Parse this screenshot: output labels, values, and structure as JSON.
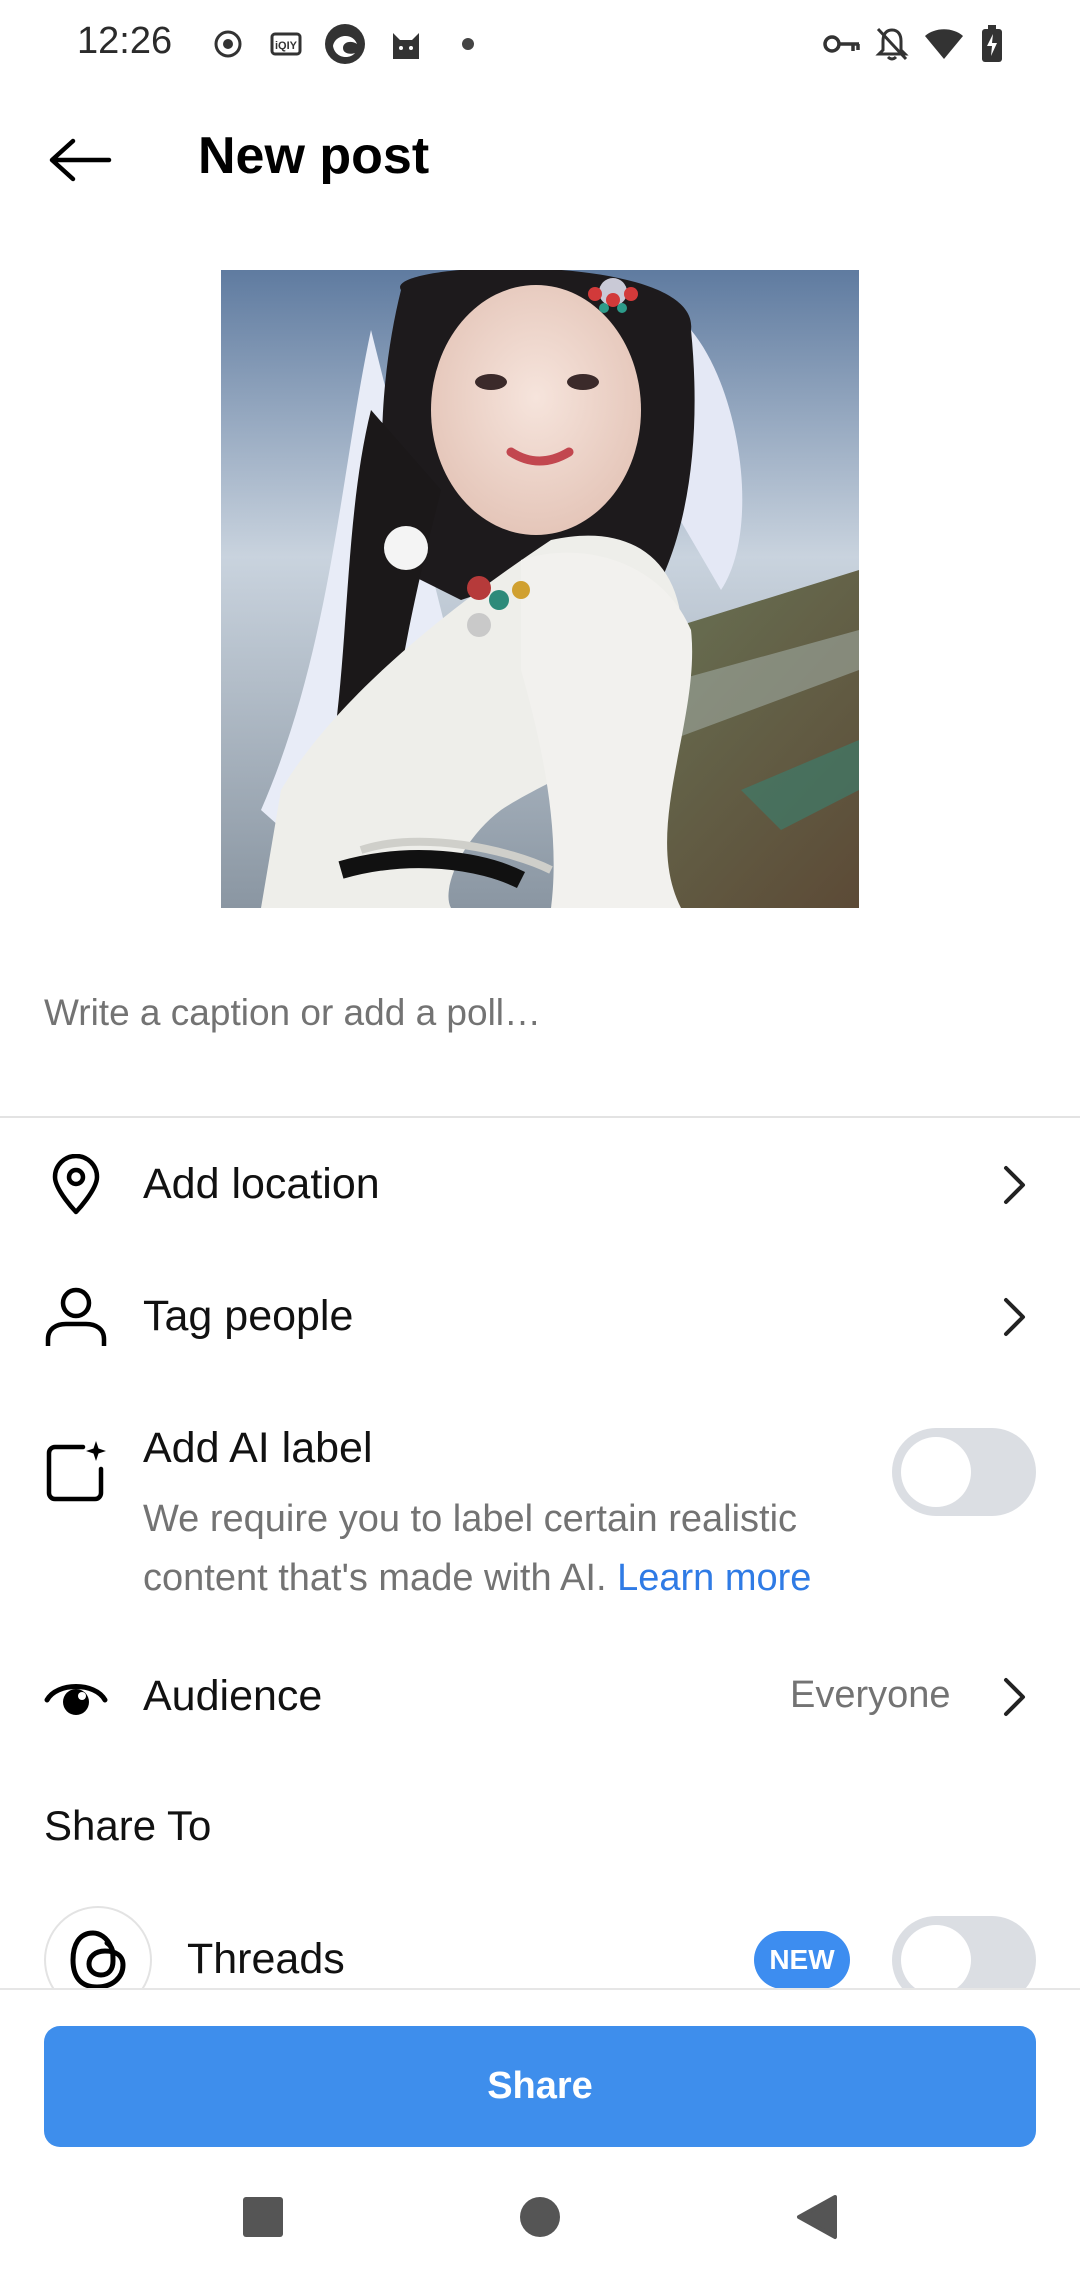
{
  "status_bar": {
    "time": "12:26",
    "left_icons": [
      "record-icon",
      "iqiyi-icon",
      "edge-browser-icon",
      "cat-app-icon",
      "dot-icon"
    ],
    "right_icons": [
      "vpn-key-icon",
      "bell-off-icon",
      "wifi-icon",
      "battery-charging-icon"
    ],
    "iqiyi_text": "iQIY"
  },
  "header": {
    "title": "New post",
    "back_icon": "arrow-left-icon"
  },
  "media": {
    "thumbnail": "photo-thumbnail"
  },
  "caption": {
    "placeholder": "Write a caption or add a poll…",
    "value": ""
  },
  "options": {
    "location": {
      "label": "Add location",
      "icon": "location-pin-icon"
    },
    "tag_people": {
      "label": "Tag people",
      "icon": "person-icon"
    },
    "ai_label": {
      "label": "Add AI label",
      "description": "We require you to label certain realistic content that's made with AI.",
      "link": "Learn more",
      "enabled": false,
      "icon": "ai-sparkle-icon"
    },
    "audience": {
      "label": "Audience",
      "value": "Everyone",
      "icon": "eye-icon"
    }
  },
  "share_to": {
    "header": "Share To",
    "threads": {
      "label": "Threads",
      "badge": "NEW",
      "enabled": false,
      "icon": "threads-logo-icon"
    }
  },
  "actions": {
    "share_label": "Share"
  },
  "nav_bar": {
    "icons": [
      "recents-square-icon",
      "home-circle-icon",
      "back-triangle-icon"
    ]
  },
  "colors": {
    "accent": "#3e8eec",
    "link": "#2f7be5",
    "secondary_text": "#737373",
    "toggle_off": "#dbdee3"
  }
}
